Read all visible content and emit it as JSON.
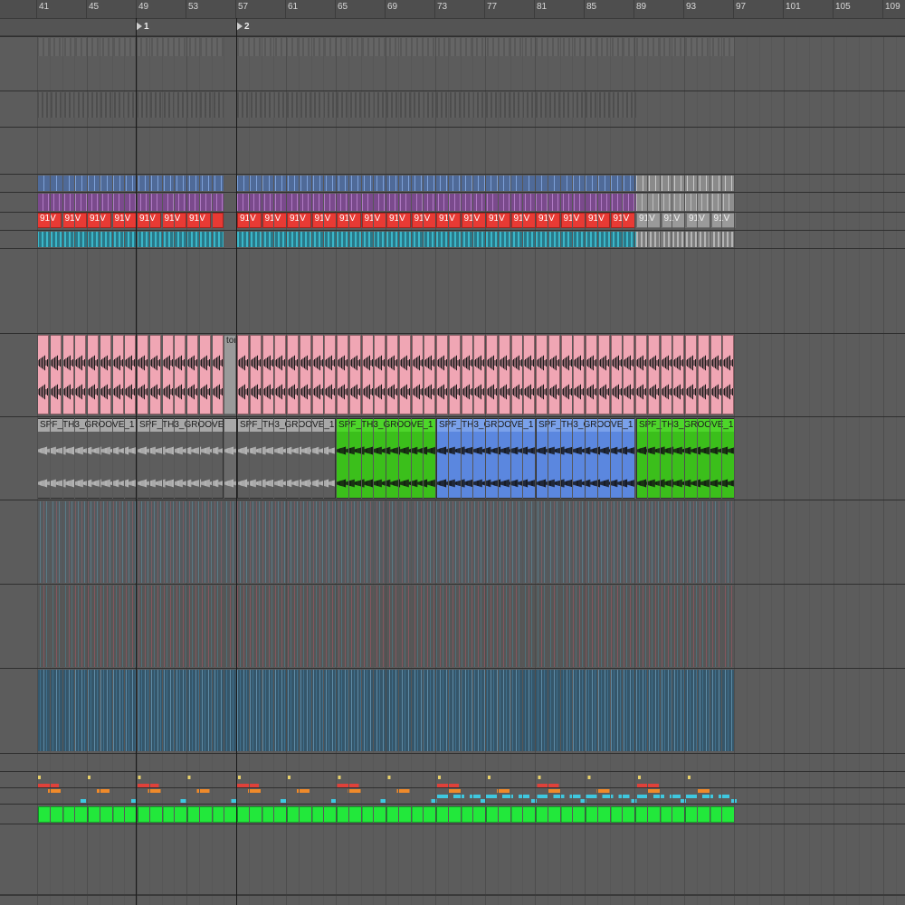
{
  "ruler": {
    "bars": [
      "41",
      "45",
      "49",
      "53",
      "57",
      "61",
      "65",
      "69",
      "73",
      "77",
      "81",
      "85",
      "89",
      "93",
      "97",
      "101",
      "105",
      "109"
    ]
  },
  "locators": [
    {
      "label": "1"
    },
    {
      "label": "2"
    }
  ],
  "clip_labels": {
    "drum_clip": "91V",
    "tom_clip": "tom",
    "groove_clip": "SPF_TH3_GROOVE_1"
  },
  "colors": {
    "background": "#5c5c5c",
    "red_clip": "#e83a34",
    "gray_clip": "#9a9a9a",
    "pink_clip": "#f0a6b4",
    "green_clip": "#3bbf1b",
    "blue_clip": "#5b87df",
    "bright_green_clip": "#22e83b",
    "purple_clip": "#7a4a8c",
    "cyan_clip": "#3bb6c8",
    "steel_blue_clip": "#3a6a85"
  }
}
